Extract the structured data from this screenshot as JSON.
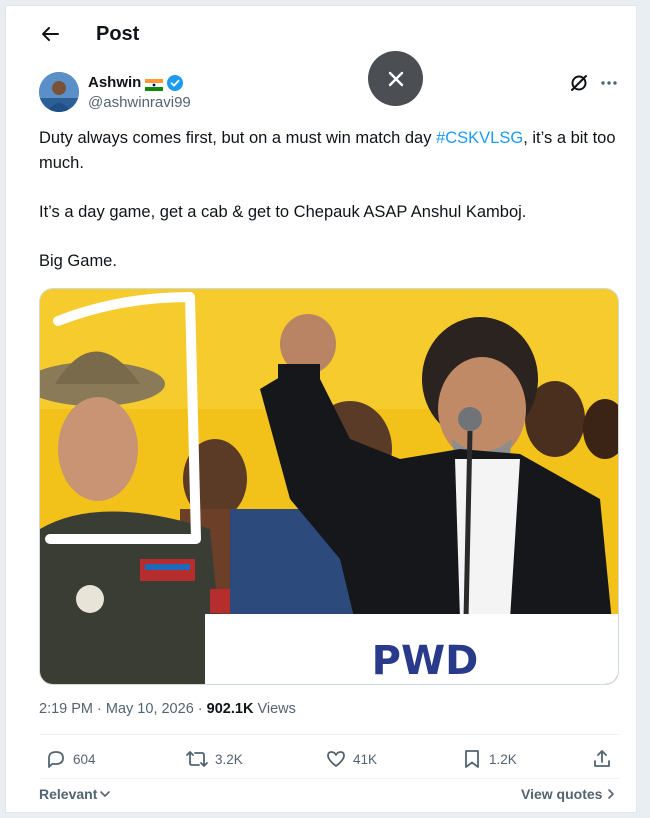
{
  "header": {
    "title": "Post"
  },
  "author": {
    "name": "Ashwin",
    "handle": "@ashwinravi99"
  },
  "tweet": {
    "line1_before": "Duty always comes first, but on a must win match day ",
    "hashtag": "#CSKVLSG",
    "line1_after": ", it’s a bit too much.",
    "paragraph2": "It’s a day game, get a cab & get to Chepauk ASAP Anshul Kamboj.",
    "paragraph3": "Big Game."
  },
  "media": {
    "banner_text": "PWD"
  },
  "meta": {
    "time": "2:19 PM",
    "date": "May 10, 2026",
    "views_count": "902.1K",
    "views_label": "Views"
  },
  "actions": {
    "replies": "604",
    "reposts": "3.2K",
    "likes": "41K",
    "bookmarks": "1.2K"
  },
  "footer": {
    "sort_label": "Relevant",
    "view_quotes": "View quotes"
  },
  "colors": {
    "link": "#1d9bf0",
    "verified": "#1d9bf0",
    "secondary_text": "#536471",
    "media_background": "#f2c21b"
  },
  "icons": [
    "back-arrow-icon",
    "verified-badge-icon",
    "india-flag-icon",
    "close-icon",
    "grok-icon",
    "more-icon",
    "reply-icon",
    "repost-icon",
    "like-icon",
    "bookmark-icon",
    "share-icon",
    "chevron-down-icon",
    "chevron-right-icon"
  ]
}
